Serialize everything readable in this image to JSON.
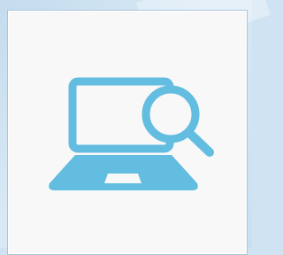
{
  "illustration": {
    "icon": "laptop-search-icon",
    "color": "#63bde0"
  },
  "theme": {
    "frame_color": "#cfe3f2",
    "panel_color": "#f8f8f8",
    "border_color": "#a9c4dc"
  }
}
